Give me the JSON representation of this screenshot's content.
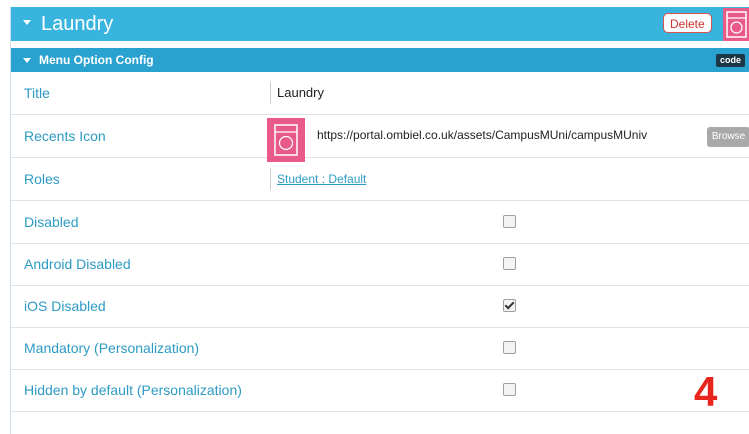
{
  "header": {
    "title": "Laundry",
    "delete_label": "Delete",
    "icon": "washing-machine-icon"
  },
  "subheader": {
    "title": "Menu Option Config",
    "code_label": "code"
  },
  "fields": {
    "title": {
      "label": "Title",
      "value": "Laundry"
    },
    "recents_icon": {
      "label": "Recents Icon",
      "url": "https://portal.ombiel.co.uk/assets/CampusMUni/campusMUniv",
      "browse_label": "Browse",
      "icon": "washing-machine-icon"
    },
    "roles": {
      "label": "Roles",
      "value": "Student : Default"
    },
    "disabled": {
      "label": "Disabled",
      "checked": false
    },
    "android_disabled": {
      "label": "Android Disabled",
      "checked": false
    },
    "ios_disabled": {
      "label": "iOS Disabled",
      "checked": true
    },
    "mandatory": {
      "label": "Mandatory (Personalization)",
      "checked": false
    },
    "hidden_default": {
      "label": "Hidden by default (Personalization)",
      "checked": false
    }
  },
  "badge": "4",
  "colors": {
    "header_bg": "#39b4de",
    "subheader_bg": "#2aa2cf",
    "label": "#2d9bc4",
    "icon_bg": "#e95a89",
    "delete": "#d0312d",
    "badge": "#e8261d"
  }
}
